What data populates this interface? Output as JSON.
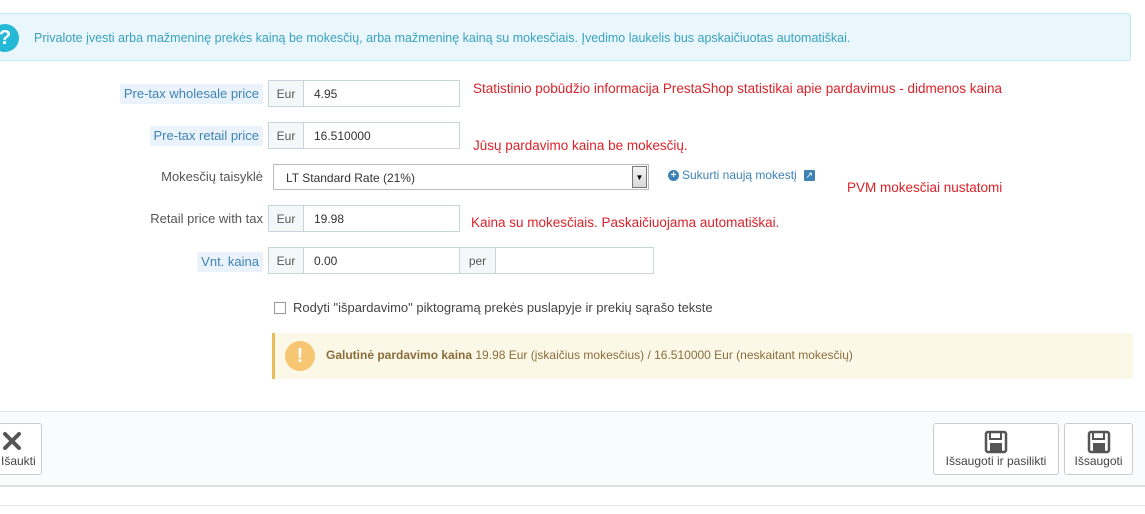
{
  "info": {
    "icon": "question-circle-icon",
    "text": "Privalote įvesti arba mažmeninę prekės kainą be mokesčių, arba mažmeninę kainą su mokesčiais. Įvedimo laukelis bus apskaičiuotas automatiškai."
  },
  "fields": {
    "wholesale": {
      "label": "Pre-tax wholesale price",
      "currency": "Eur",
      "value": "4.95"
    },
    "retail": {
      "label": "Pre-tax retail price",
      "currency": "Eur",
      "value": "16.510000"
    },
    "tax_rule": {
      "label": "Mokesčių taisyklė",
      "selected": "LT Standard Rate (21%)"
    },
    "retail_with_tax": {
      "label": "Retail price with tax",
      "currency": "Eur",
      "value": "19.98"
    },
    "unit_price": {
      "label": "Vnt. kaina",
      "currency": "Eur",
      "value": "0.00",
      "per_label": "per",
      "per_value": ""
    }
  },
  "new_tax_link": "Sukurti naują mokestį",
  "notes": {
    "wholesale": "Statistinio pobūdžio informacija PrestaShop statistikai apie pardavimus - didmenos kaina",
    "retail": "Jūsų pardavimo kaina be mokesčių.",
    "tax": "PVM mokesčiai nustatomi",
    "with_tax": "Kaina su mokesčiais. Paskaičiuojama automatiškai."
  },
  "sale_checkbox": {
    "label": "Rodyti \"išpardavimo\" piktogramą prekės puslapyje ir prekių sąrašo tekste",
    "checked": false
  },
  "final_price": {
    "title": "Galutinė pardavimo kaina",
    "text": " 19.98 Eur (įskaičius mokesčius) / 16.510000 Eur (neskaitant mokesčių)"
  },
  "footer": {
    "cancel": "Išaukti",
    "save_stay": "Išsaugoti ir pasilikti",
    "save": "Išsaugoti"
  },
  "colors": {
    "accent": "#25b9d7",
    "note_red": "#d9232a",
    "link_blue": "#3e82b5",
    "warning": "#f7c673"
  }
}
